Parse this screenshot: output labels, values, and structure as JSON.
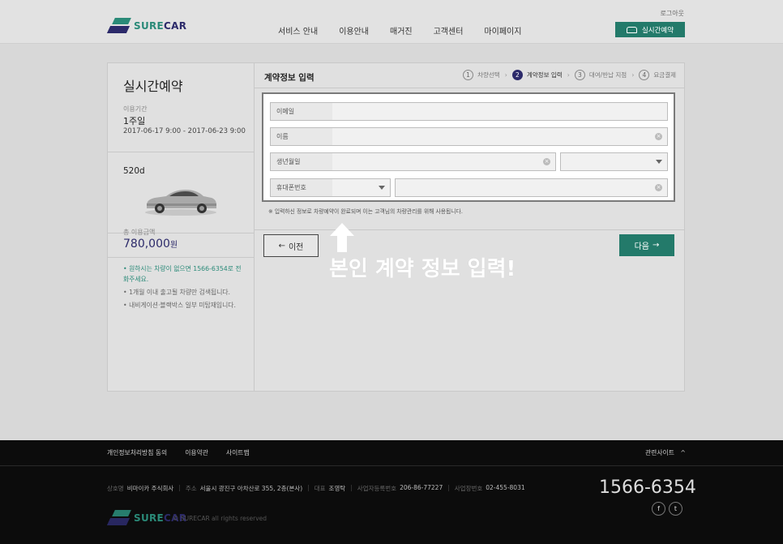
{
  "header": {
    "brand": "SURECAR",
    "brand_a": "SURE",
    "brand_b": "CAR",
    "logout": "로그아웃",
    "nav": [
      "서비스 안내",
      "이용안내",
      "매거진",
      "고객센터",
      "마이페이지"
    ],
    "reserve_label": "실시간예약"
  },
  "sidebar": {
    "title": "실시간예약",
    "period_label": "이용기간",
    "period_value": "1주일",
    "dates": "2017-06-17  9:00 - 2017-06-23  9:00",
    "car_name": "520d",
    "total_label": "총 이용금액",
    "total_price": "780,000",
    "total_unit": "원",
    "notes": [
      "• 원하시는 차량이 없으면 1566-6354로 전화주세요.",
      "• 1개월 이내 출고될 차량만 검색됩니다.",
      "• 내비게이션·블랙박스 일부 미탑재입니다."
    ]
  },
  "main": {
    "title": "계약정보 입력",
    "steps": [
      {
        "num": "1",
        "label": "차량선택"
      },
      {
        "num": "2",
        "label": "계약정보 입력"
      },
      {
        "num": "3",
        "label": "대여/반납 지점"
      },
      {
        "num": "4",
        "label": "요금결제"
      }
    ],
    "active_step": 2,
    "fields": {
      "email_label": "이메일",
      "name_label": "이름",
      "birth_label": "생년월일",
      "phone_label": "휴대폰번호"
    },
    "note": "※ 입력하신 정보로 차량예약이 완료되며 이는 고객님의 차량관리를 위해 사용됩니다.",
    "prev_label": "이전",
    "next_label": "다음"
  },
  "annotation": "본인 계약 정보 입력!",
  "footer": {
    "links": [
      "개인정보처리방침 동의",
      "이용약관",
      "사이트맵"
    ],
    "related": "관련사이트",
    "company": [
      {
        "k": "상호명",
        "v": "비마이카 주식회사"
      },
      {
        "k": "주소",
        "v": "서울시 광진구 아차산로 355, 2층(본사)"
      },
      {
        "k": "대표",
        "v": "조영탁"
      },
      {
        "k": "사업자등록번호",
        "v": "206-86-77227"
      },
      {
        "k": "사업장번호",
        "v": "02-455-8031"
      }
    ],
    "phone": "1566-6354",
    "social": [
      "f",
      "t"
    ],
    "copyright": "© SURECAR all rights reserved"
  },
  "colors": {
    "brand_green": "#237a6a",
    "brand_navy": "#2c2a6a"
  }
}
